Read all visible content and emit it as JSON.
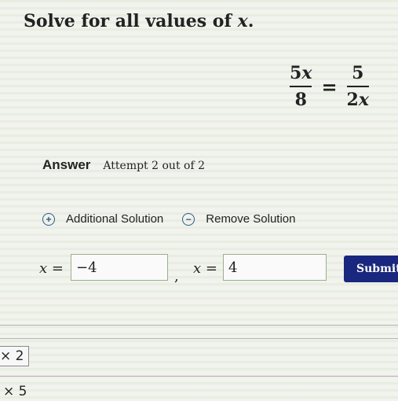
{
  "question": {
    "prefix": "Solve for all values of ",
    "variable": "x",
    "suffix": "."
  },
  "equation": {
    "left_num_coef": "5",
    "left_num_var": "x",
    "left_den": "8",
    "equals": "=",
    "right_num": "5",
    "right_den_coef": "2",
    "right_den_var": "x"
  },
  "answer": {
    "label": "Answer",
    "attempt": "Attempt 2 out of 2"
  },
  "solutions": {
    "add_label": "Additional Solution",
    "remove_label": "Remove Solution",
    "add_icon": "+",
    "remove_icon": "−"
  },
  "inputs": {
    "var1": "x =",
    "value1": "−4",
    "comma": ",",
    "var2": "x =",
    "value2": "4",
    "submit_label": "Submit"
  },
  "scratch": {
    "line1": "× 2",
    "line2": "× 5"
  },
  "colors": {
    "submit_bg": "#19277e",
    "icon_blue": "#2f5a8a"
  }
}
